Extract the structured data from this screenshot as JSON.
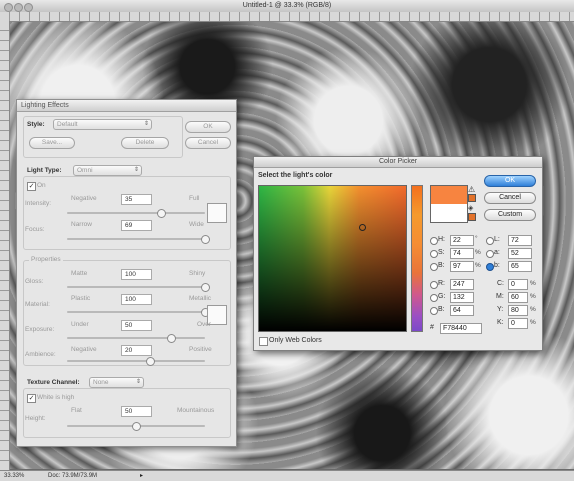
{
  "document": {
    "title": "Untitled-1 @ 33.3% (RGB/8)",
    "status_zoom": "33.33%",
    "status_doc": "Doc: 73.9M/73.9M"
  },
  "lighting_effects": {
    "title": "Lighting Effects",
    "style_label": "Style:",
    "style_value": "Default",
    "save_label": "Save...",
    "delete_label": "Delete",
    "ok_label": "OK",
    "cancel_label": "Cancel",
    "light_type_label": "Light Type:",
    "light_type_value": "Omni",
    "on_label": "On",
    "intensity": {
      "label": "Intensity:",
      "min": "Negative",
      "max": "Full",
      "value": "35",
      "level": 0.68
    },
    "focus": {
      "label": "Focus:",
      "min": "Narrow",
      "max": "Wide",
      "value": "69",
      "level": 1.0
    },
    "properties_label": "Properties",
    "gloss": {
      "label": "Gloss:",
      "min": "Matte",
      "max": "Shiny",
      "value": "100",
      "level": 1.0
    },
    "material": {
      "label": "Material:",
      "min": "Plastic",
      "max": "Metallic",
      "value": "100",
      "level": 1.0
    },
    "exposure": {
      "label": "Exposure:",
      "min": "Under",
      "max": "Over",
      "value": "50",
      "level": 0.75
    },
    "ambience": {
      "label": "Ambience:",
      "min": "Negative",
      "max": "Positive",
      "value": "20",
      "level": 0.6
    },
    "texture_channel_label": "Texture Channel:",
    "texture_channel_value": "None",
    "white_is_high_label": "White is high",
    "height": {
      "label": "Height:",
      "min": "Flat",
      "max": "Mountainous",
      "value": "50",
      "level": 0.5
    }
  },
  "color_picker": {
    "title": "Color Picker",
    "prompt": "Select the light's color",
    "ok_label": "OK",
    "cancel_label": "Cancel",
    "custom_label": "Custom",
    "only_web_colors_label": "Only Web Colors",
    "hex_prefix": "#",
    "hex_value": "F78440",
    "new_color": "#f78440",
    "old_color": "#ffffff",
    "hsb": [
      {
        "key": "H:",
        "value": "22",
        "unit": "°"
      },
      {
        "key": "S:",
        "value": "74",
        "unit": "%"
      },
      {
        "key": "B:",
        "value": "97",
        "unit": "%"
      }
    ],
    "rgb": [
      {
        "key": "R:",
        "value": "247"
      },
      {
        "key": "G:",
        "value": "132"
      },
      {
        "key": "B:",
        "value": "64"
      }
    ],
    "lab": [
      {
        "key": "L:",
        "value": "72"
      },
      {
        "key": "a:",
        "value": "52"
      },
      {
        "key": "b:",
        "value": "65"
      }
    ],
    "cmyk": [
      {
        "key": "C:",
        "value": "0",
        "unit": "%"
      },
      {
        "key": "M:",
        "value": "60",
        "unit": "%"
      },
      {
        "key": "Y:",
        "value": "80",
        "unit": "%"
      },
      {
        "key": "K:",
        "value": "0",
        "unit": "%"
      }
    ]
  }
}
